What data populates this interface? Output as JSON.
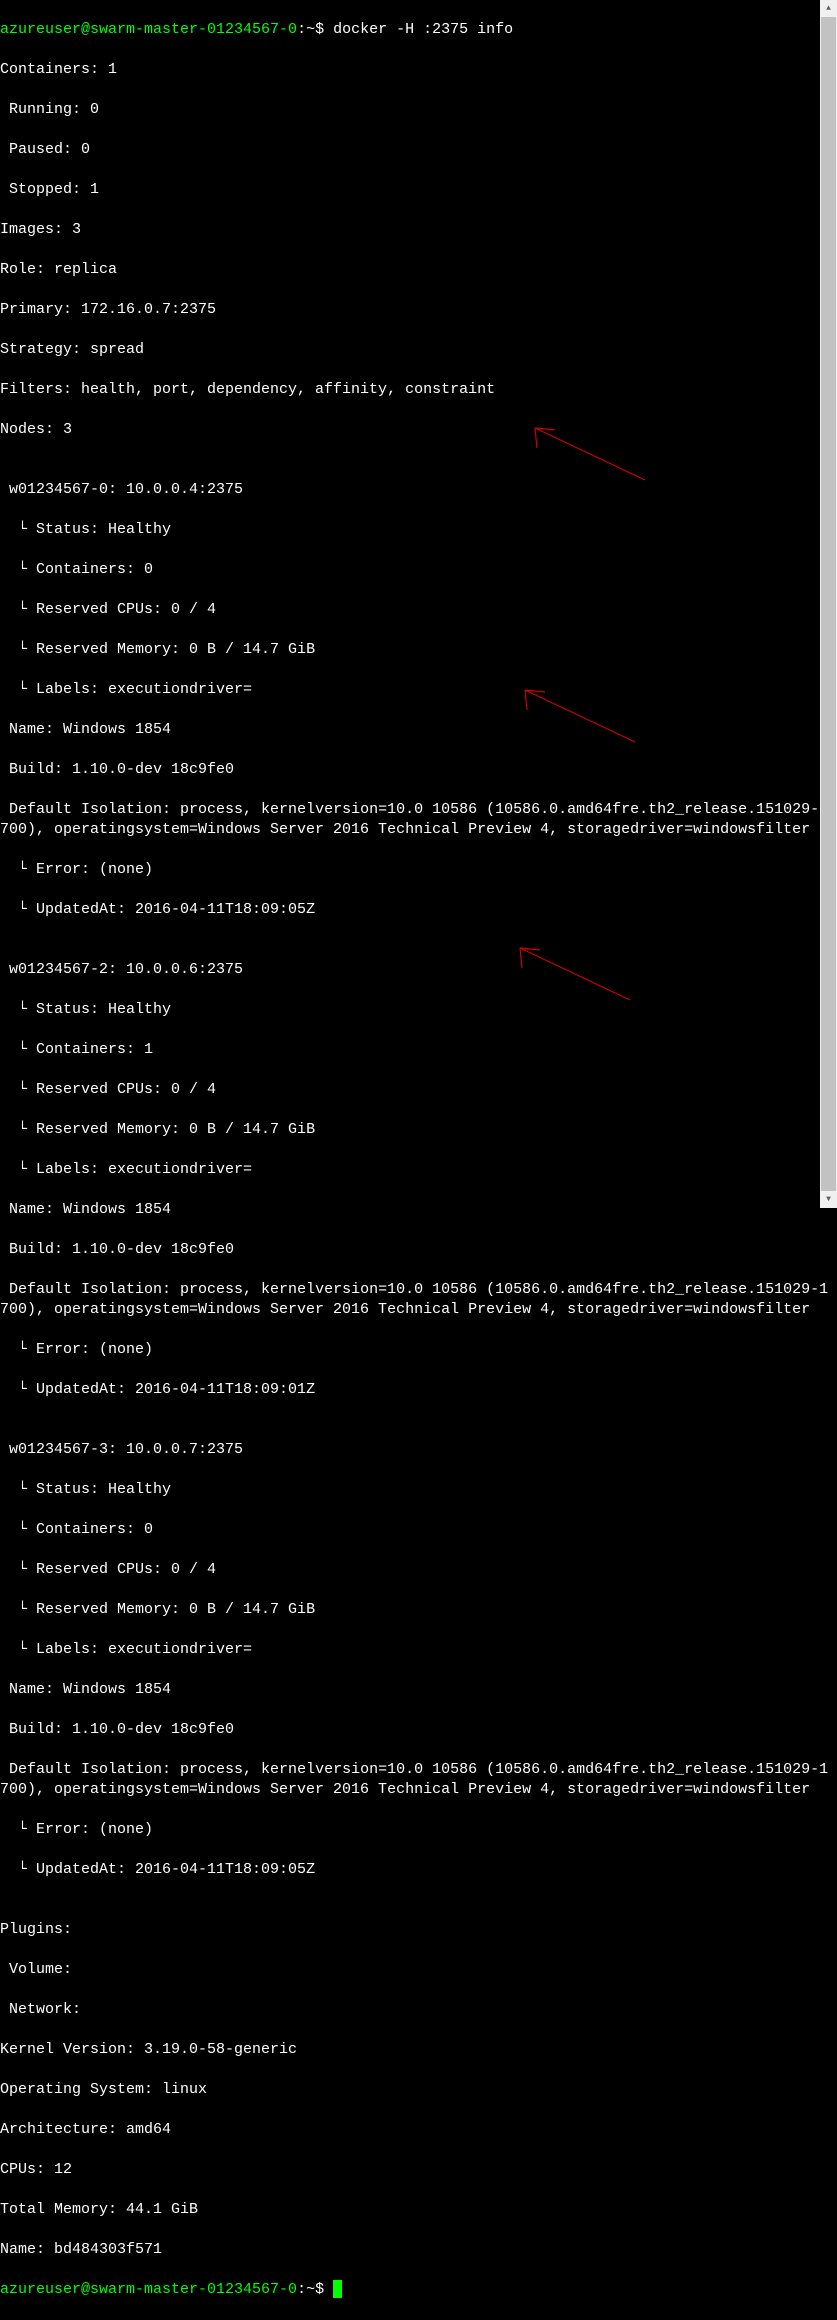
{
  "prompt1": {
    "user_host": "azureuser@swarm-master-01234567-0",
    "path": ":~$ ",
    "command": "docker -H :2375 info"
  },
  "header": {
    "containers": "Containers: 1",
    "running": " Running: 0",
    "paused": " Paused: 0",
    "stopped": " Stopped: 1",
    "images": "Images: 3",
    "role": "Role: replica",
    "primary": "Primary: 172.16.0.7:2375",
    "strategy": "Strategy: spread",
    "filters": "Filters: health, port, dependency, affinity, constraint",
    "nodes": "Nodes: 3"
  },
  "node1": {
    "title": " w01234567-0: 10.0.0.4:2375",
    "status": "  └ Status: Healthy",
    "containers": "  └ Containers: 0",
    "cpus": "  └ Reserved CPUs: 0 / 4",
    "memory": "  └ Reserved Memory: 0 B / 14.7 GiB",
    "labels": "  └ Labels: executiondriver=",
    "name": " Name: Windows 1854",
    "build": " Build: 1.10.0-dev 18c9fe0",
    "isolation": " Default Isolation: process, kernelversion=10.0 10586 (10586.0.amd64fre.th2_release.151029-1700), operatingsystem=Windows Server 2016 Technical Preview 4, storagedriver=windowsfilter",
    "error": "  └ Error: (none)",
    "updated": "  └ UpdatedAt: 2016-04-11T18:09:05Z"
  },
  "node2": {
    "title": " w01234567-2: 10.0.0.6:2375",
    "status": "  └ Status: Healthy",
    "containers": "  └ Containers: 1",
    "cpus": "  └ Reserved CPUs: 0 / 4",
    "memory": "  └ Reserved Memory: 0 B / 14.7 GiB",
    "labels": "  └ Labels: executiondriver=",
    "name": " Name: Windows 1854",
    "build": " Build: 1.10.0-dev 18c9fe0",
    "isolation": " Default Isolation: process, kernelversion=10.0 10586 (10586.0.amd64fre.th2_release.151029-1700), operatingsystem=Windows Server 2016 Technical Preview 4, storagedriver=windowsfilter",
    "error": "  └ Error: (none)",
    "updated": "  └ UpdatedAt: 2016-04-11T18:09:01Z"
  },
  "node3": {
    "title": " w01234567-3: 10.0.0.7:2375",
    "status": "  └ Status: Healthy",
    "containers": "  └ Containers: 0",
    "cpus": "  └ Reserved CPUs: 0 / 4",
    "memory": "  └ Reserved Memory: 0 B / 14.7 GiB",
    "labels": "  └ Labels: executiondriver=",
    "name": " Name: Windows 1854",
    "build": " Build: 1.10.0-dev 18c9fe0",
    "isolation": " Default Isolation: process, kernelversion=10.0 10586 (10586.0.amd64fre.th2_release.151029-1700), operatingsystem=Windows Server 2016 Technical Preview 4, storagedriver=windowsfilter",
    "error": "  └ Error: (none)",
    "updated": "  └ UpdatedAt: 2016-04-11T18:09:05Z"
  },
  "footer": {
    "plugins": "Plugins:",
    "volume": " Volume:",
    "network": " Network:",
    "kernel": "Kernel Version: 3.19.0-58-generic",
    "os": "Operating System: linux",
    "arch": "Architecture: amd64",
    "cpus": "CPUs: 12",
    "memory": "Total Memory: 44.1 GiB",
    "name": "Name: bd484303f571"
  },
  "prompt2": {
    "user_host": "azureuser@swarm-master-01234567-0",
    "path": ":~$ "
  }
}
